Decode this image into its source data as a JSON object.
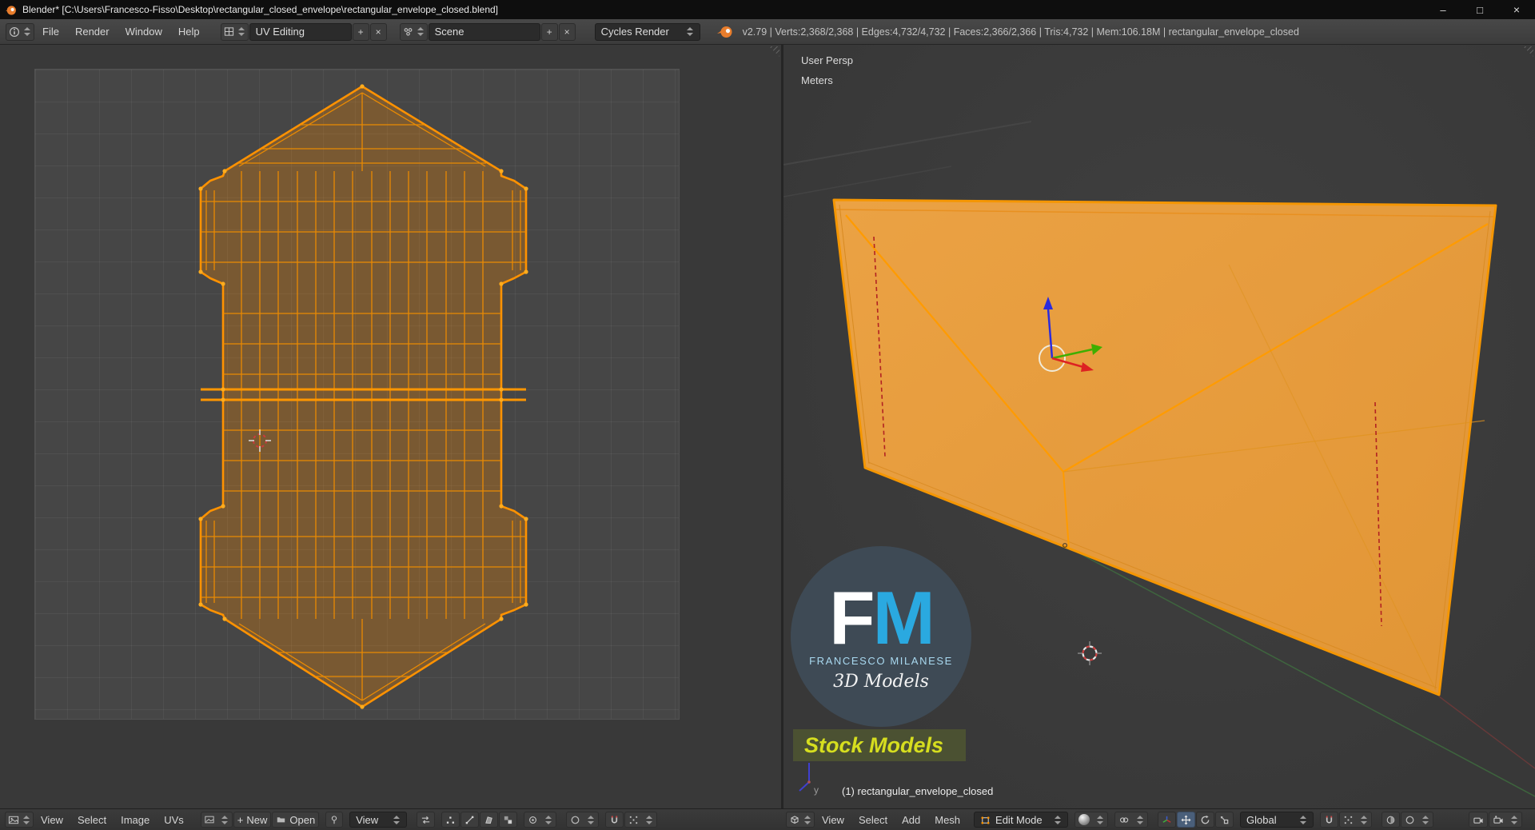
{
  "window": {
    "title": "Blender* [C:\\Users\\Francesco-Fisso\\Desktop\\rectangular_closed_envelope\\rectangular_envelope_closed.blend]"
  },
  "icons": {
    "plus": "+",
    "close": "×",
    "minimize": "–",
    "maximize": "□"
  },
  "topbar": {
    "menus": [
      "File",
      "Render",
      "Window",
      "Help"
    ],
    "layout_field": "UV Editing",
    "scene_field": "Scene",
    "engine_field": "Cycles Render",
    "stats": "v2.79 | Verts:2,368/2,368 | Edges:4,732/4,732 | Faces:2,366/2,366 | Tris:4,732 | Mem:106.18M | rectangular_envelope_closed"
  },
  "uv_editor": {
    "menus": [
      "View",
      "Select",
      "Image",
      "UVs"
    ],
    "new_button": "New",
    "open_button": "Open",
    "mode_dropdown": "View"
  },
  "view3d": {
    "view_name": "User Persp",
    "unit_label": "Meters",
    "object_info": "(1) rectangular_envelope_closed",
    "menus": [
      "View",
      "Select",
      "Add",
      "Mesh"
    ],
    "mode_dropdown": "Edit Mode",
    "orientation_dropdown": "Global",
    "gizmo_axis_label": "y"
  },
  "watermark": {
    "letter_f": "F",
    "letter_m": "M",
    "name": "FRANCESCO MILANESE",
    "tagline": "3D Models",
    "badge": "Stock Models"
  },
  "colors": {
    "selection_orange": "#ff9600",
    "mesh_fill": "#f1a13f",
    "uv_face_fill": "rgba(255,140,0,0.28)",
    "seam_red": "#b22222",
    "axis_x_red": "#dd2222",
    "axis_y_green": "#3fae00",
    "axis_z_blue": "#2b2bdd",
    "logo_blue": "#2aa9e0",
    "badge_text": "#d6de1f",
    "badge_bg": "#4b5132",
    "watermark_bg": "#3e4a55"
  }
}
